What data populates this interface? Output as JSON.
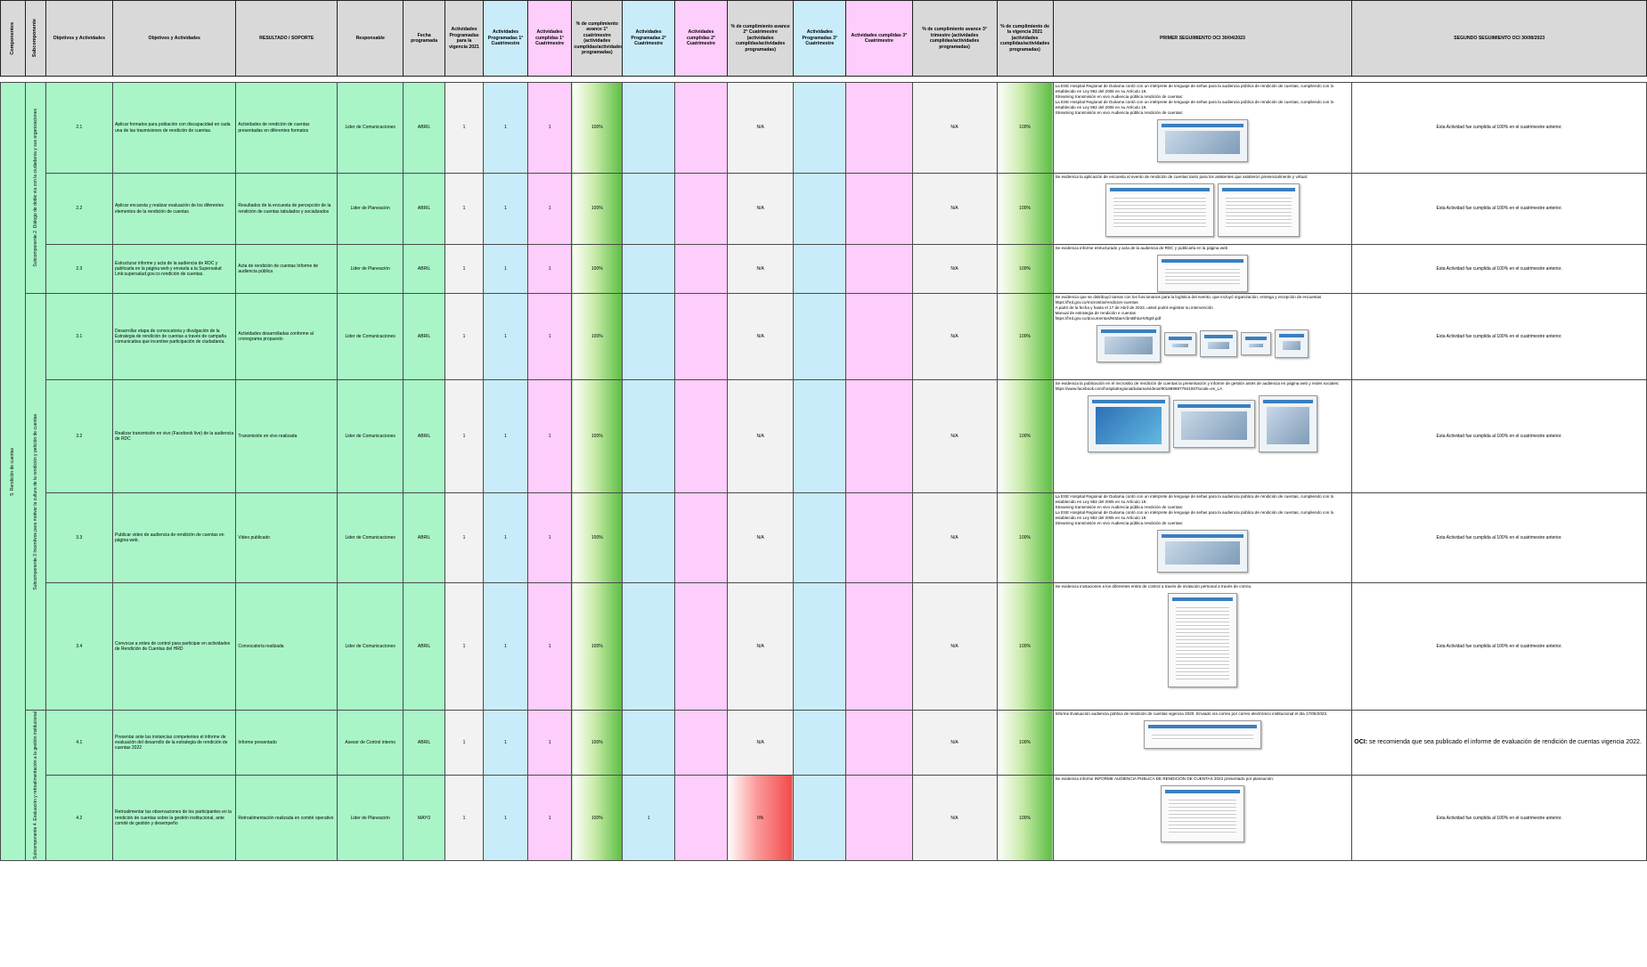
{
  "headers": [
    "Componentes",
    "Subcomponente",
    "Objetivos y Actividades",
    "Objetivos y Actividades",
    "RESULTADO / SOPORTE",
    "Responsable",
    "Fecha programada",
    "Actividades Programadas para la vigencia 2021",
    "Actividades Programadas 1° Cuatrimestre",
    "Actividades cumplidas 1° Cuatrimestre",
    "% de cumplimiento avance 1° cuatrimestre (actividades cumplidas/actividades programadas)",
    "Actividades Programadas 2° Cuatrimestre",
    "Actividades cumplidas 2° Cuatrimestre",
    "% de cumplimiento avance 2° Cuatrimestre (actividades cumplidas/actividades programadas)",
    "Actividades Programadas 3° Cuatrimestre",
    "Actividades cumplidas 3° Cuatrimestre",
    "% de cumplimiento avance 3° trimestre (actividades cumplidas/actividades programadas)",
    "% de cumplimiento de la vigencia 2021 (actividades cumplidas/actividades programadas)",
    "PRIMER SEGUIMIENTO OCI 30/04/2023",
    "SEGUNDO SEGUIMIENTO OCI 30/08/2023"
  ],
  "component": "5. Rendición de cuentas",
  "subcomponents": [
    "Subcomponente 2. Diálogo de doble vía con la ciudadanía y sus organizaciones",
    "Subcomponente 3 Incentivos para motivar la cultura de la rendición y petición de cuentas",
    "Subcomponente 4. Evaluación y retroalimentación a la gestión institucional"
  ],
  "rows": [
    {
      "num": "2.1",
      "actividad": "Aplicar formatos para población con discapacidad en cada una de las trasmisiones de rendición de cuentas.",
      "resultado": "Actividades de rendición de cuentas presentadas en diferentes formatos",
      "responsable": "Lider de Comunicaciones",
      "fecha": "ABRIL",
      "prog_vig": "1",
      "prog1": "1",
      "cump1": "1",
      "pct1": "100%",
      "prog2": "",
      "cump2": "",
      "pct2": "N/A",
      "prog3": "",
      "cump3": "",
      "pct3": "N/A",
      "pct_vig": "100%",
      "primer": "La ESE Hospital Regional de Duitama contó con un intérprete de lenguaje de señas para la audiencia pública de rendición de cuentas, cumpliendo con lo establecido en Ley 982 del 2005 en su Artículo 19.\nStreaming transmisión en vivo Audiencia pública rendición de cuentas:\nLa ESE Hospital Regional de Duitama contó con un intérprete de lenguaje de señas para la audiencia pública de rendición de cuentas, cumpliendo con lo establecido en Ley 982 del 2005 en su Artículo 19.\nStreaming transmisión en vivo Audiencia pública rendición de cuentas:",
      "segundo": "Esta Actividad fue cumplida al 100% en el cuatrimestre anterior."
    },
    {
      "num": "2.2",
      "actividad": "Aplicar encuesta y realizar evaluación de los diferentes elementos de la rendición de cuentas",
      "resultado": "Resultados de la encuesta de percepción de la rendición de cuentas tabulados y socializados",
      "responsable": "Lider de Planeación",
      "fecha": "ABRIL",
      "prog_vig": "1",
      "prog1": "1",
      "cump1": "1",
      "pct1": "100%",
      "prog2": "",
      "cump2": "",
      "pct2": "N/A",
      "prog3": "",
      "cump3": "",
      "pct3": "N/A",
      "pct_vig": "100%",
      "primer": "Se evidencia la aplicación de encuesta al evento de rendición de cuentas tanto para los asistentes que asistieron presencialmente y virtual.",
      "segundo": "Esta Actividad fue cumplida al 100% en el cuatrimestre anterior."
    },
    {
      "num": "2.3",
      "actividad": "Estructurar informe y acta de la audiencia de RDC y publicarla en la página web y enviarla a la Supersalud Link:supersalud.gov.co rendición de cuentas.",
      "resultado": "Acta de rendición de cuentas Informe de audiencia pública",
      "responsable": "Lider de Planeación",
      "fecha": "ABRIL",
      "prog_vig": "1",
      "prog1": "1",
      "cump1": "1",
      "pct1": "100%",
      "prog2": "",
      "cump2": "",
      "pct2": "N/A",
      "prog3": "",
      "cump3": "",
      "pct3": "N/A",
      "pct_vig": "100%",
      "primer": "Se evidencia informe estructurado y acta de la audiencia de RDC y publicarla en la página web",
      "segundo": "Esta Actividad fue cumplida al 100% en el cuatrimestre anterior."
    },
    {
      "num": "3.1",
      "actividad": "Desarrollar etapa de convocatoria y divulgación de la Estrategia de rendición de cuentas a través de campaña comunicativa que incentive participación de ciudadanía.",
      "resultado": "Actividades desarrolladas conforme al cronograma propuesto",
      "responsable": "Lider de Comunicaciones",
      "fecha": "ABRIL",
      "prog_vig": "1",
      "prog1": "1",
      "cump1": "1",
      "pct1": "100%",
      "prog2": "",
      "cump2": "",
      "pct2": "N/A",
      "prog3": "",
      "cump3": "",
      "pct3": "N/A",
      "pct_vig": "100%",
      "primer": "Se evidencia que se distribuyó tareas con los funcionarios para la logística del evento, que incluyó organización, entrega y recepción de encuestas\nhttps://hrd.gov.co/micrositio/rendicion-cuentas\nA partir de la fecha y hasta el 17 de Abril de 2023, usted podrá registrar su intervención\nManual de estrategia de rendición e cuentas\nhttps://hrd.gov.co/documentos/N0daIAcbmBhtuHV8g0l.pdf",
      "segundo": "Esta Actividad fue cumplida al 100% en el cuatrimestre anterior."
    },
    {
      "num": "3.2",
      "actividad": "Realizar transmisión en vivo (Facebook live) de la audiencia de RDC",
      "resultado": "Transmisión en vivo realizada",
      "responsable": "Lider de Comunicaciones",
      "fecha": "ABRIL",
      "prog_vig": "1",
      "prog1": "1",
      "cump1": "1",
      "pct1": "100%",
      "prog2": "",
      "cump2": "",
      "pct2": "N/A",
      "prog3": "",
      "cump3": "",
      "pct3": "N/A",
      "pct_vig": "100%",
      "primer": "Se evidencia la publicación en el micrositio de rendición de cuentas la presentación y informe de gestión antes de audiencia en página web y redes sociales:\nhttps://www.facebook.com/hospitalregionalduitama/videos/9018699877841067locale=es_LA",
      "segundo": "Esta Actividad fue cumplida al 100% en el cuatrimestre anterior."
    },
    {
      "num": "3.3",
      "actividad": "Publicar video de audiencia de rendición de cuentas en página web.",
      "resultado": "Video publicado",
      "responsable": "Lider de Comunicaciones",
      "fecha": "ABRIL",
      "prog_vig": "1",
      "prog1": "1",
      "cump1": "1",
      "pct1": "100%",
      "prog2": "",
      "cump2": "",
      "pct2": "N/A",
      "prog3": "",
      "cump3": "",
      "pct3": "N/A",
      "pct_vig": "100%",
      "primer": "La ESE Hospital Regional de Duitama contó con un intérprete de lenguaje de señas para la audiencia pública de rendición de cuentas, cumpliendo con lo establecido en Ley 982 del 2005 en su Artículo 19.\nStreaming transmisión en vivo Audiencia pública rendición de cuentas:\nLa ESE Hospital Regional de Duitama contó con un intérprete de lenguaje de señas para la audiencia pública de rendición de cuentas, cumpliendo con lo establecido en Ley 982 del 2005 en su Artículo 19.\nStreaming transmisión en vivo Audiencia pública rendición de cuentas:",
      "segundo": "Esta Actividad fue cumplida al 100% en el cuatrimestre anterior."
    },
    {
      "num": "3.4",
      "actividad": "Convocar a entes de control para participar en actividades de Rendición de Cuentas del HRD",
      "resultado": "Convocatoria realizada",
      "responsable": "Lider de Comunicaciones",
      "fecha": "ABRIL",
      "prog_vig": "1",
      "prog1": "1",
      "cump1": "1",
      "pct1": "100%",
      "prog2": "",
      "cump2": "",
      "pct2": "N/A",
      "prog3": "",
      "cump3": "",
      "pct3": "N/A",
      "pct_vig": "100%",
      "primer": "Se evidencia invitaciones a los diferentes entes de control a través de invitación personal a través de correo.",
      "segundo": "Esta Actividad fue cumplida al 100% en el cuatrimestre anterior."
    },
    {
      "num": "4.1",
      "actividad": "Presentar ante las instancias competentes el informe de evaluación del desarrollo de la estrategia de rendición de cuentas 2022",
      "resultado": "Informe presentado",
      "responsable": "Asesor de Control interno",
      "fecha": "ABRIL",
      "prog_vig": "1",
      "prog1": "1",
      "cump1": "1",
      "pct1": "100%",
      "prog2": "",
      "cump2": "",
      "pct2": "N/A",
      "prog3": "",
      "cump3": "",
      "pct3": "N/A",
      "pct_vig": "100%",
      "primer": "Informe Evaluación audiencia pública de rendición de cuentas vigencia 2020. Enviado vía correo por correo electrónico institucional el día 17/05/2023.",
      "segundo_label": "OCI:",
      "segundo": "se recomienda que sea publicado el informe de evaluación de rendición de cuentas vigencia 2022."
    },
    {
      "num": "4.2",
      "actividad": "Retroalimentar las observaciones de los participantes en la rendición de cuentas sobre la gestión institucional, ante comité de gestión y desempeño",
      "resultado": "Retroalimentación realizada en comité operativo",
      "responsable": "Lider de Planeación",
      "fecha": "MAYO",
      "prog_vig": "1",
      "prog1": "1",
      "cump1": "1",
      "pct1": "100%",
      "prog2": "1",
      "cump2": "",
      "pct2": "0%",
      "prog3": "",
      "cump3": "",
      "pct3": "N/A",
      "pct_vig": "100%",
      "primer": "Se evidencia informe INFORME AUDIENCIA PÚBLICA DE RENDICIÓN DE CUENTAS 2022 presentado por planeación:",
      "segundo": "Esta Actividad fue cumplida al 100% en el cuatrimestre anterior."
    }
  ]
}
